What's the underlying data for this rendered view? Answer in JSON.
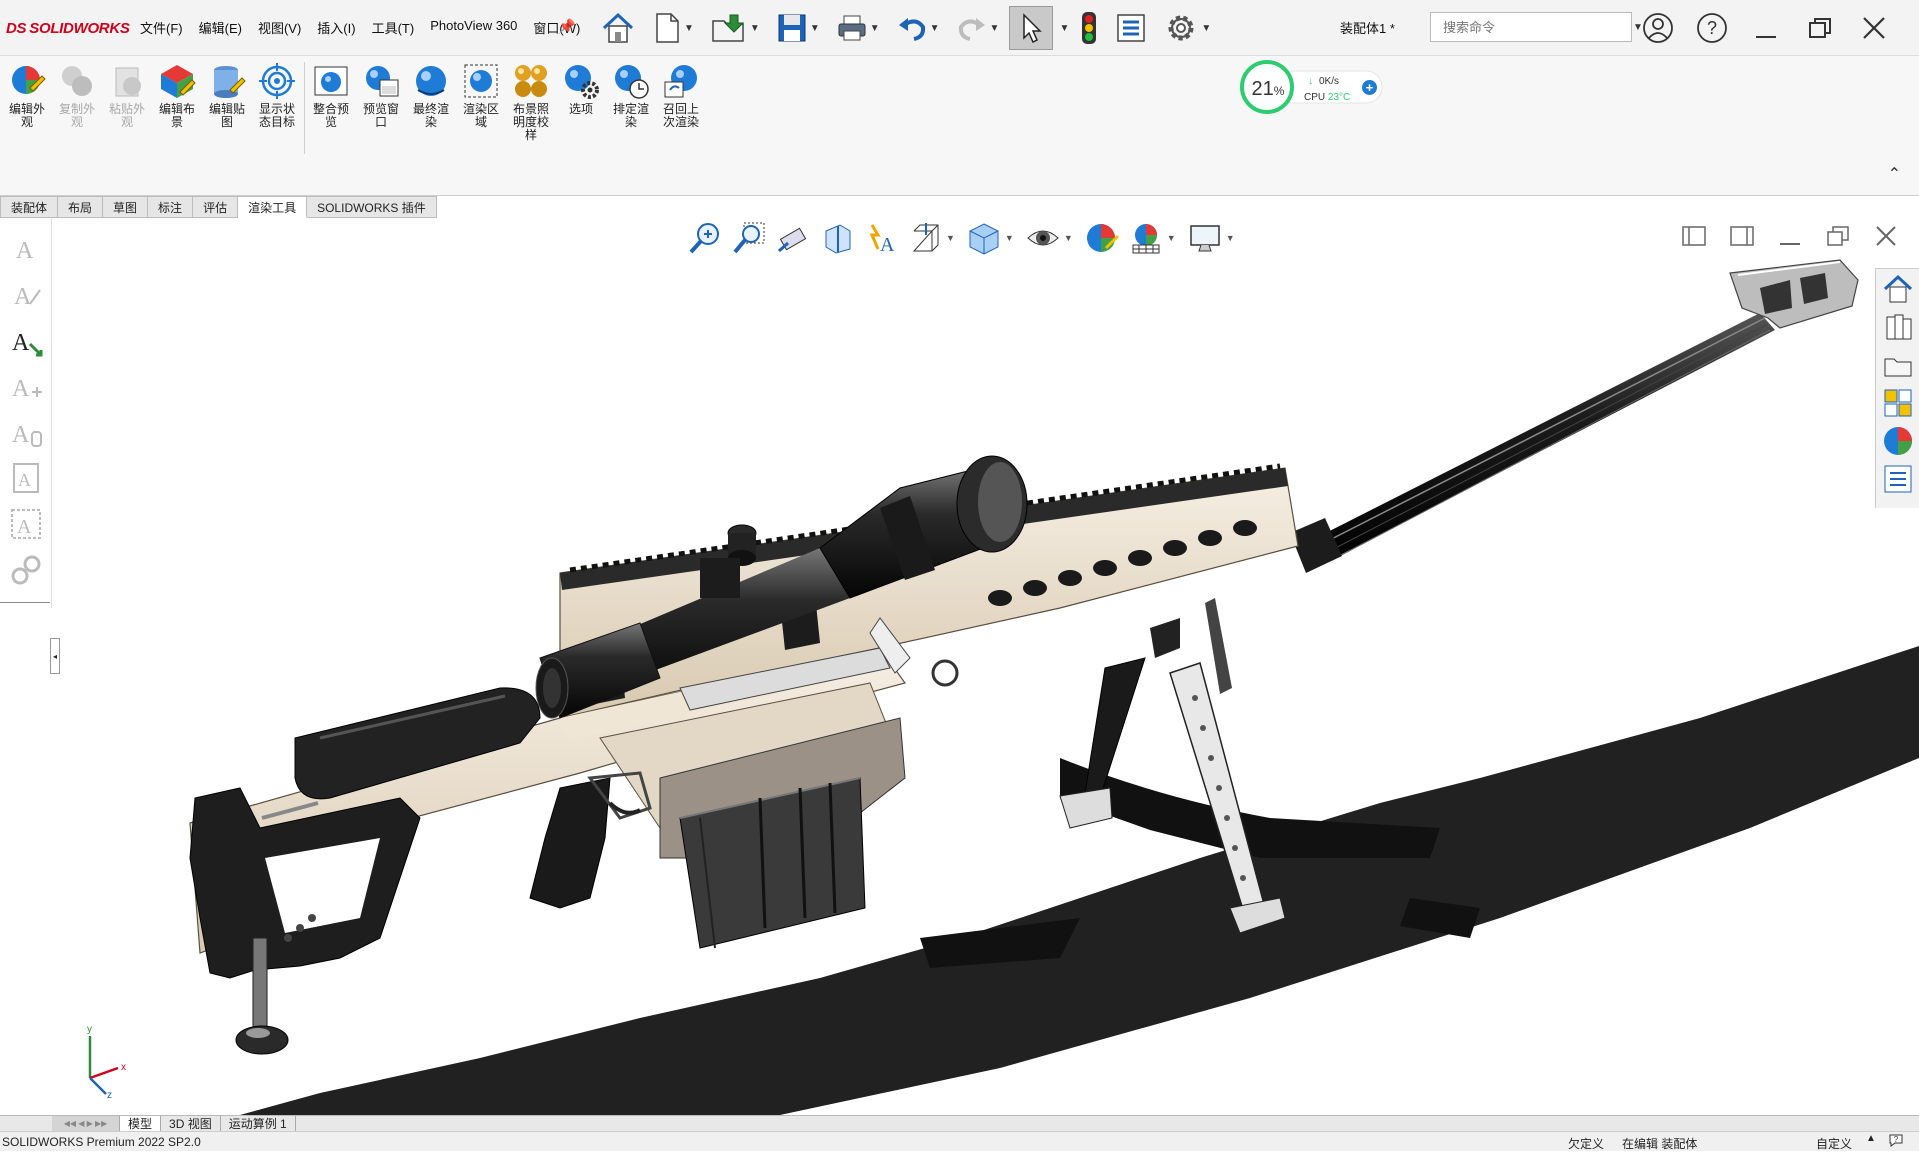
{
  "app": {
    "logo_mark": "DS",
    "logo_text": "SOLIDWORKS"
  },
  "menu": [
    "文件(F)",
    "编辑(E)",
    "视图(V)",
    "插入(I)",
    "工具(T)",
    "PhotoView 360",
    "窗口(W)"
  ],
  "document": {
    "title": "装配体1 *"
  },
  "search": {
    "placeholder": "搜索命令"
  },
  "ribbon": {
    "buttons": [
      {
        "label": "编辑外观",
        "enabled": true,
        "icon": "edit-appearance-icon"
      },
      {
        "label": "复制外观",
        "enabled": false,
        "icon": "copy-appearance-icon"
      },
      {
        "label": "粘贴外观",
        "enabled": false,
        "icon": "paste-appearance-icon"
      },
      {
        "label": "编辑布景",
        "enabled": true,
        "icon": "edit-scene-icon"
      },
      {
        "label": "编辑贴图",
        "enabled": true,
        "icon": "edit-decal-icon"
      },
      {
        "label": "显示状态目标",
        "enabled": true,
        "icon": "target-icon"
      },
      {
        "label": "整合预览",
        "enabled": true,
        "icon": "integrated-preview-icon"
      },
      {
        "label": "预览窗口",
        "enabled": true,
        "icon": "preview-window-icon"
      },
      {
        "label": "最终渲染",
        "enabled": true,
        "icon": "final-render-icon"
      },
      {
        "label": "渲染区域",
        "enabled": true,
        "icon": "render-region-icon"
      },
      {
        "label": "布景照明度校样",
        "enabled": true,
        "icon": "scene-illumination-icon"
      },
      {
        "label": "选项",
        "enabled": true,
        "icon": "options-icon"
      },
      {
        "label": "排定渲染",
        "enabled": true,
        "icon": "schedule-render-icon"
      },
      {
        "label": "召回上次渲染",
        "enabled": true,
        "icon": "recall-render-icon"
      }
    ]
  },
  "cpu_widget": {
    "percent": "21",
    "percent_sign": "%",
    "net": "0K/s",
    "cpu_label": "CPU",
    "temp": "23°C",
    "plus": "+"
  },
  "tabs": {
    "items": [
      "装配体",
      "布局",
      "草图",
      "标注",
      "评估",
      "渲染工具",
      "SOLIDWORKS 插件"
    ],
    "active": 5
  },
  "bottom_tabs": {
    "items": [
      "模型",
      "3D 视图",
      "运动算例 1"
    ],
    "active": 0
  },
  "status": {
    "product": "SOLIDWORKS Premium 2022 SP2.0",
    "state": "欠定义",
    "mode": "在编辑 装配体",
    "units": "自定义",
    "caret": "▲",
    "icon": "help-icon"
  },
  "triad": {
    "x": "x",
    "y": "y",
    "z": "z"
  },
  "colors": {
    "accent_red": "#d0021b",
    "cpu_green": "#2ecc71",
    "blue": "#1e7bd6",
    "rail_tan": "#e8dcc8"
  }
}
